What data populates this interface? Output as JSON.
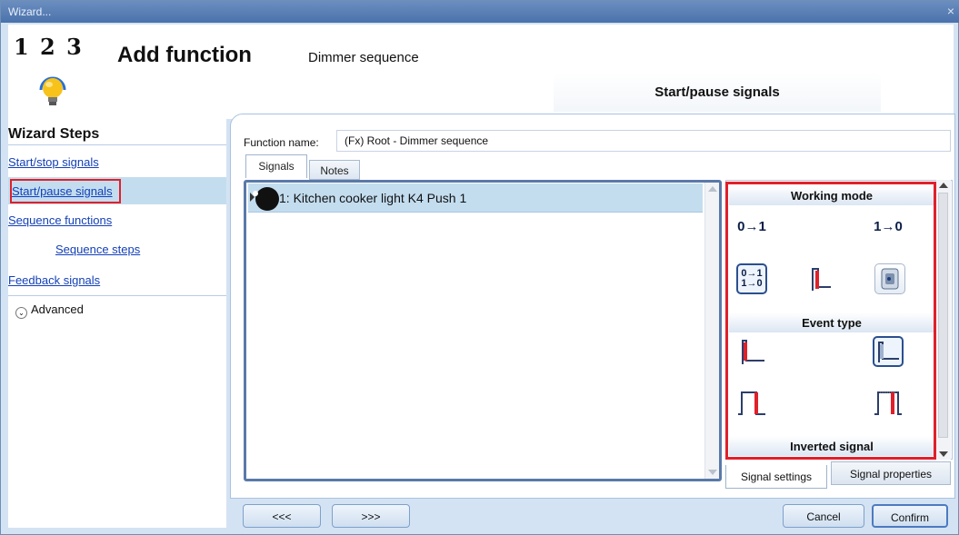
{
  "window": {
    "title": "Wizard...",
    "close_glyph": "×"
  },
  "header": {
    "logo_digits": "1 2 3",
    "title": "Add function",
    "subtitle": "Dimmer sequence",
    "step_tab": "Start/pause signals"
  },
  "sidebar": {
    "title": "Wizard Steps",
    "items": [
      {
        "label": "Start/stop signals"
      },
      {
        "label": "Start/pause signals"
      },
      {
        "label": "Sequence functions"
      },
      {
        "label": "Sequence steps"
      },
      {
        "label": "Feedback signals"
      }
    ],
    "advanced_label": "Advanced"
  },
  "main": {
    "function_name_label": "Function name:",
    "function_name_value": "(Fx) Root - Dimmer sequence",
    "tabs": [
      {
        "label": "Signals"
      },
      {
        "label": "Notes"
      }
    ],
    "signals": [
      {
        "label": "1: Kitchen cooker light K4 Push 1"
      }
    ]
  },
  "properties": {
    "sections": {
      "working_mode": "Working mode",
      "event_type": "Event type",
      "inverted_signal": "Inverted signal"
    },
    "working_mode_icons": [
      {
        "text": "0→1",
        "icon": "rising-edge-icon"
      },
      {
        "text": "1→0",
        "icon": "falling-edge-icon"
      },
      {
        "text": "0→1 1→0",
        "icon": "both-edges-icon"
      },
      {
        "icon": "pulse-icon"
      },
      {
        "icon": "switch-icon"
      }
    ],
    "tabs": [
      {
        "label": "Signal settings"
      },
      {
        "label": "Signal properties"
      }
    ]
  },
  "footer": {
    "prev_label": "<<<",
    "next_label": ">>>",
    "cancel_label": "Cancel",
    "confirm_label": "Confirm"
  },
  "colors": {
    "highlight": "#e0202a",
    "selection": "#c3ddef",
    "link": "#1440b8"
  }
}
